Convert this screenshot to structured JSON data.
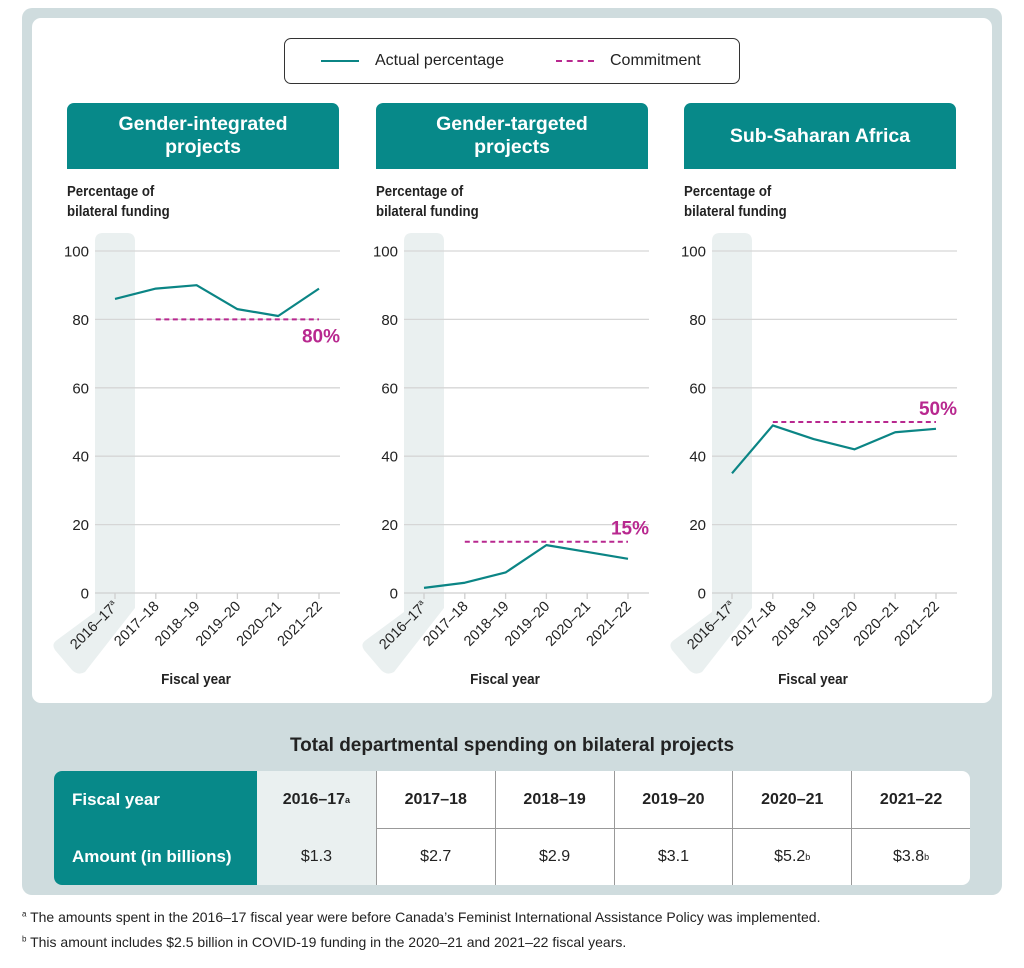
{
  "legend": {
    "actual_label": "Actual percentage",
    "commitment_label": "Commitment"
  },
  "colors": {
    "teal": "#078989",
    "line": "#0b8585",
    "commitment": "#b8288f",
    "background": "#cfdcde",
    "shade": "#eaf0f0"
  },
  "chart_data": [
    {
      "type": "line",
      "title": "Gender-integrated projects",
      "title_lines": [
        "Gender-integrated",
        "projects"
      ],
      "ylabel_lines": [
        "Percentage of",
        "bilateral funding"
      ],
      "xlabel": "Fiscal year",
      "categories": [
        "2016–17",
        "2017–18",
        "2018–19",
        "2019–20",
        "2020–21",
        "2021–22"
      ],
      "category_superscripts": [
        "a",
        "",
        "",
        "",
        "",
        ""
      ],
      "yticks": [
        0,
        20,
        40,
        60,
        80,
        100
      ],
      "ylim": [
        0,
        100
      ],
      "grid": true,
      "highlighted_category": "2016–17",
      "series": [
        {
          "name": "Actual percentage",
          "values": [
            86,
            89,
            90,
            83,
            81,
            89
          ]
        }
      ],
      "commitment": {
        "name": "Commitment",
        "value": 80,
        "from": "2017–18",
        "to": "2021–22",
        "label": "80%"
      }
    },
    {
      "type": "line",
      "title": "Gender-targeted projects",
      "title_lines": [
        "Gender-targeted",
        "projects"
      ],
      "ylabel_lines": [
        "Percentage of",
        "bilateral funding"
      ],
      "xlabel": "Fiscal year",
      "categories": [
        "2016–17",
        "2017–18",
        "2018–19",
        "2019–20",
        "2020–21",
        "2021–22"
      ],
      "category_superscripts": [
        "a",
        "",
        "",
        "",
        "",
        ""
      ],
      "yticks": [
        0,
        20,
        40,
        60,
        80,
        100
      ],
      "ylim": [
        0,
        100
      ],
      "grid": true,
      "highlighted_category": "2016–17",
      "series": [
        {
          "name": "Actual percentage",
          "values": [
            1.5,
            3,
            6,
            14,
            12,
            10
          ]
        }
      ],
      "commitment": {
        "name": "Commitment",
        "value": 15,
        "from": "2017–18",
        "to": "2021–22",
        "label": "15%"
      }
    },
    {
      "type": "line",
      "title": "Sub-Saharan Africa",
      "title_lines": [
        "Sub-Saharan Africa"
      ],
      "ylabel_lines": [
        "Percentage of",
        "bilateral funding"
      ],
      "xlabel": "Fiscal year",
      "categories": [
        "2016–17",
        "2017–18",
        "2018–19",
        "2019–20",
        "2020–21",
        "2021–22"
      ],
      "category_superscripts": [
        "a",
        "",
        "",
        "",
        "",
        ""
      ],
      "yticks": [
        0,
        20,
        40,
        60,
        80,
        100
      ],
      "ylim": [
        0,
        100
      ],
      "grid": true,
      "highlighted_category": "2016–17",
      "series": [
        {
          "name": "Actual percentage",
          "values": [
            35,
            49,
            45,
            42,
            47,
            48
          ]
        }
      ],
      "commitment": {
        "name": "Commitment",
        "value": 50,
        "from": "2017–18",
        "to": "2021–22",
        "label": "50%"
      }
    }
  ],
  "table": {
    "title": "Total departmental spending on bilateral projects",
    "row_headers": [
      "Fiscal year",
      "Amount (in billions)"
    ],
    "columns": [
      {
        "year": "2016–17",
        "year_sup": "a",
        "amount": "$1.3",
        "amount_sup": ""
      },
      {
        "year": "2017–18",
        "year_sup": "",
        "amount": "$2.7",
        "amount_sup": ""
      },
      {
        "year": "2018–19",
        "year_sup": "",
        "amount": "$2.9",
        "amount_sup": ""
      },
      {
        "year": "2019–20",
        "year_sup": "",
        "amount": "$3.1",
        "amount_sup": ""
      },
      {
        "year": "2020–21",
        "year_sup": "",
        "amount": "$5.2",
        "amount_sup": "b"
      },
      {
        "year": "2021–22",
        "year_sup": "",
        "amount": "$3.8",
        "amount_sup": "b"
      }
    ]
  },
  "footnotes": [
    {
      "marker": "a",
      "text": "The amounts spent in the 2016–17 fiscal year were before Canada’s Feminist International Assistance Policy was implemented."
    },
    {
      "marker": "b",
      "text": "This amount includes $2.5 billion in COVID-19 funding in the 2020–21 and 2021–22 fiscal years."
    }
  ]
}
